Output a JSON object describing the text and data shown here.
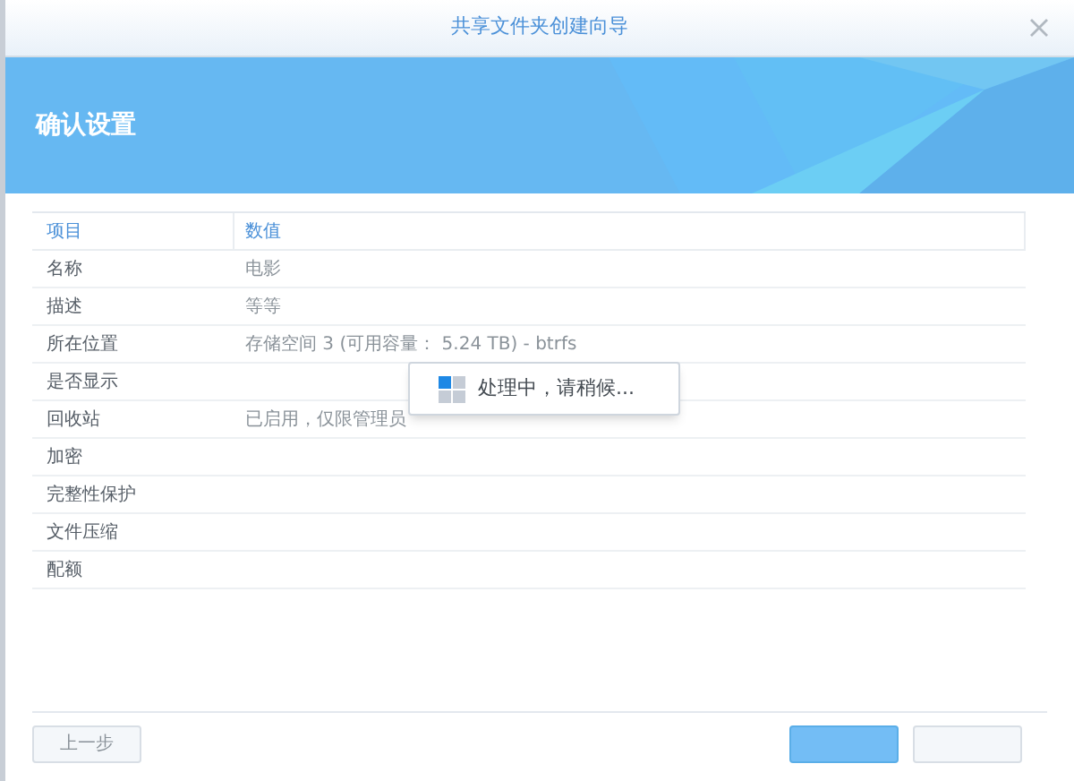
{
  "window": {
    "title": "共享文件夹创建向导"
  },
  "banner": {
    "title": "确认设置"
  },
  "table": {
    "columns": [
      "项目",
      "数值"
    ],
    "rows": [
      {
        "item": "名称",
        "value": "电影"
      },
      {
        "item": "描述",
        "value": "等等"
      },
      {
        "item": "所在位置",
        "value": "存储空间 3 (可用容量： 5.24 TB) - btrfs"
      },
      {
        "item": "是否显示"
      },
      {
        "item": "回收站",
        "value": "已启用，仅限管理员"
      },
      {
        "item": "加密"
      },
      {
        "item": "完整性保护"
      },
      {
        "item": "文件压缩"
      },
      {
        "item": "配额"
      }
    ]
  },
  "loading": {
    "text": "处理中，请稍候..."
  },
  "buttons": [
    {
      "label": "上一步",
      "kind": "secondary"
    },
    {
      "kind": "primary"
    },
    {
      "kind": "secondary"
    }
  ]
}
